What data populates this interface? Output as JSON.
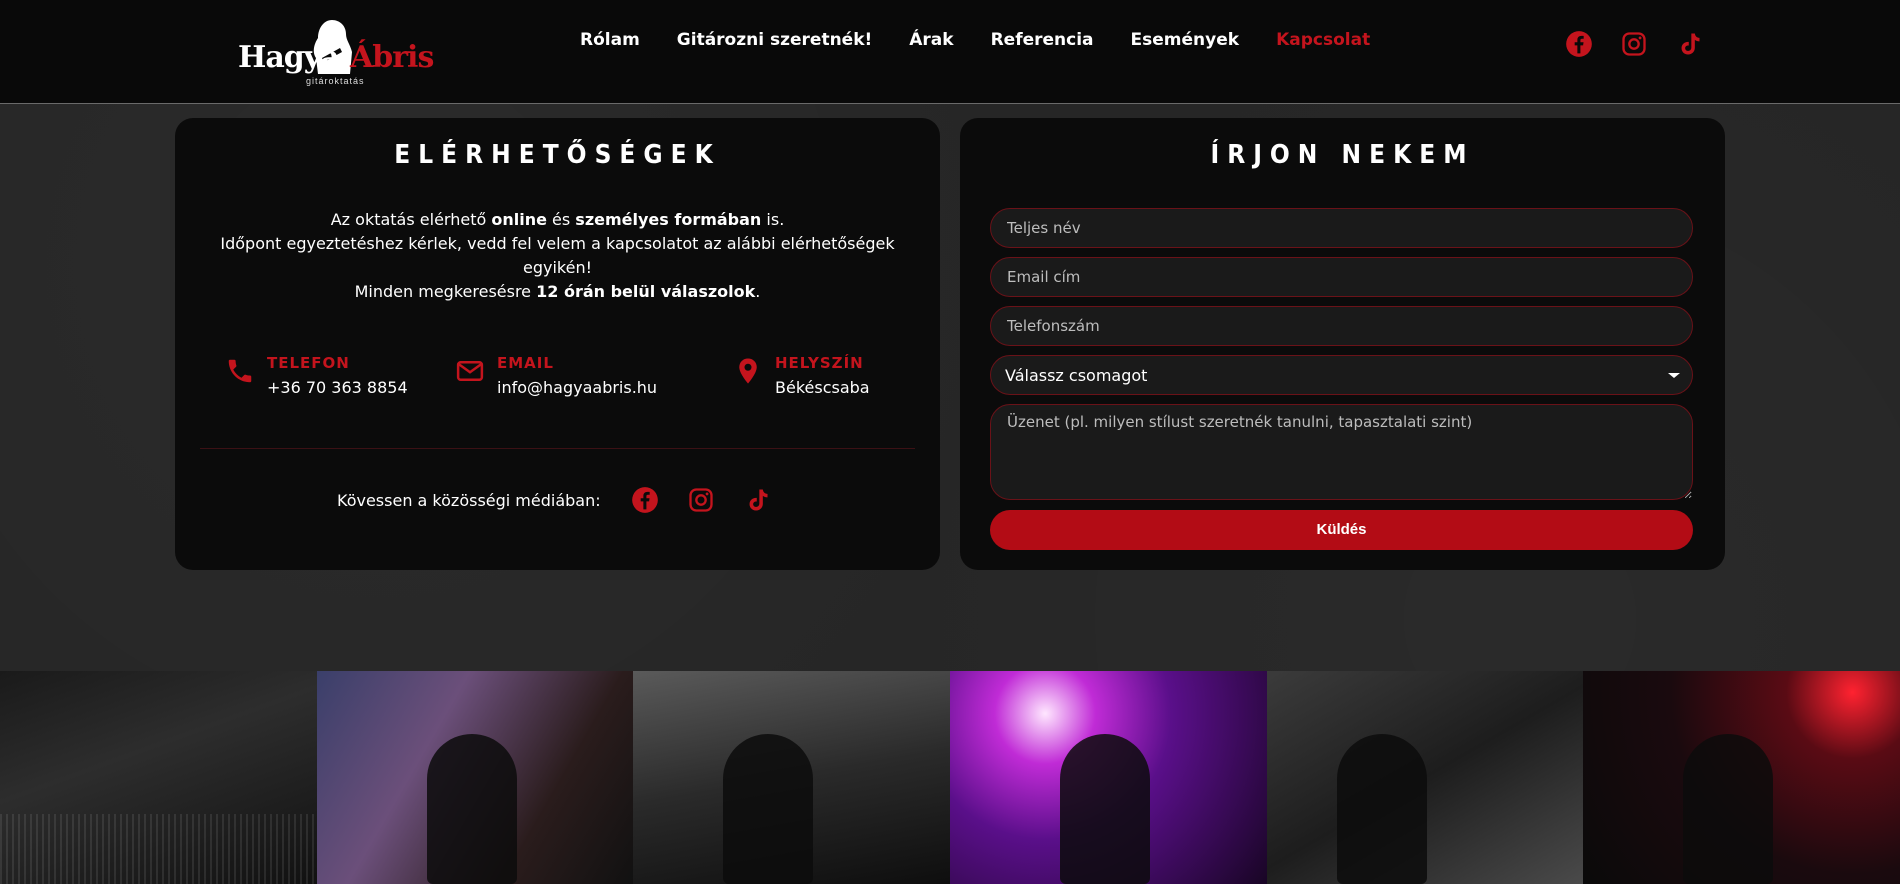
{
  "header": {
    "logo": {
      "part1": "Hagya",
      "part2": "Ábris",
      "subtitle": "gitároktatás"
    },
    "nav": [
      "Rólam",
      "Gitározni szeretnék!",
      "Árak",
      "Referencia",
      "Események",
      "Kapcsolat"
    ],
    "active_nav": "Kapcsolat",
    "social_icons": [
      "facebook-icon",
      "instagram-icon",
      "tiktok-icon"
    ]
  },
  "contact_card": {
    "title": "ELÉRHETŐSÉGEK",
    "intro": {
      "l1_pre": "Az oktatás elérhető ",
      "l1_b1": "online",
      "l1_mid": " és ",
      "l1_b2": "személyes formában",
      "l1_post": " is.",
      "l2": "Időpont egyeztetéshez kérlek, vedd fel velem a kapcsolatot az alábbi elérhetőségek egyikén!",
      "l3_pre": "Minden megkeresésre ",
      "l3_b": "12 órán belül válaszolok",
      "l3_post": "."
    },
    "items": [
      {
        "label": "TELEFON",
        "value": "+36 70 363 8854",
        "icon": "phone-icon"
      },
      {
        "label": "EMAIL",
        "value": "info@hagyaabris.hu",
        "icon": "envelope-icon"
      },
      {
        "label": "HELYSZÍN",
        "value": "Békéscsaba",
        "icon": "location-pin-icon"
      }
    ],
    "follow_text": "Kövessen a közösségi médiában:"
  },
  "form_card": {
    "title": "ÍRJON NEKEM",
    "name_placeholder": "Teljes név",
    "email_placeholder": "Email cím",
    "phone_placeholder": "Telefonszám",
    "package_value": "Válassz csomagot",
    "message_placeholder": "Üzenet (pl. milyen stílust szeretnék tanulni, tapasztalati szint)",
    "send_label": "Küldés"
  },
  "colors": {
    "accent": "#c4141d",
    "button": "#b30c15",
    "card": "#0b0b0b",
    "page": "#262626"
  }
}
